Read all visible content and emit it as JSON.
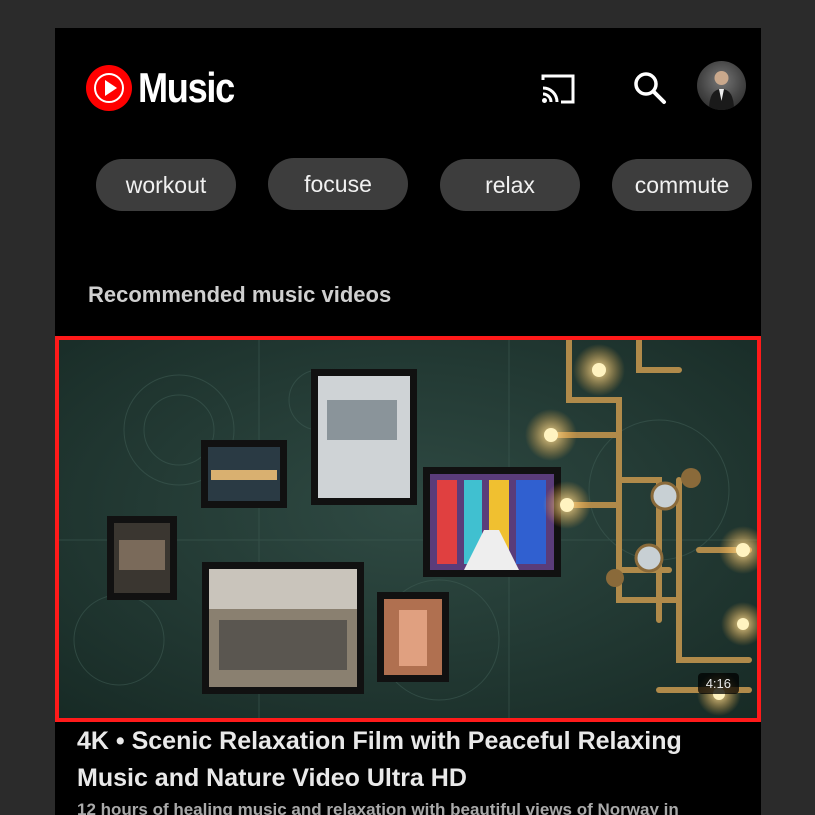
{
  "header": {
    "app_name": "Music",
    "icons": [
      "youtube-music-logo-icon",
      "cast-icon",
      "search-icon",
      "avatar"
    ]
  },
  "chips": [
    {
      "label": "workout"
    },
    {
      "label": "focuse"
    },
    {
      "label": "relax"
    },
    {
      "label": "commute"
    }
  ],
  "section": {
    "title": "Recommended music videos"
  },
  "video": {
    "duration": "4:16",
    "title": "4K • Scenic Relaxation Film with Peaceful Relaxing Music and Nature Video Ultra HD",
    "subtitle": "12 hours of healing music and relaxation with beautiful views of Norway in"
  },
  "colors": {
    "brand_red": "#ff0000",
    "highlight_border": "#ff1a1a",
    "chip_bg": "#3d3d3d",
    "background": "#000000"
  }
}
